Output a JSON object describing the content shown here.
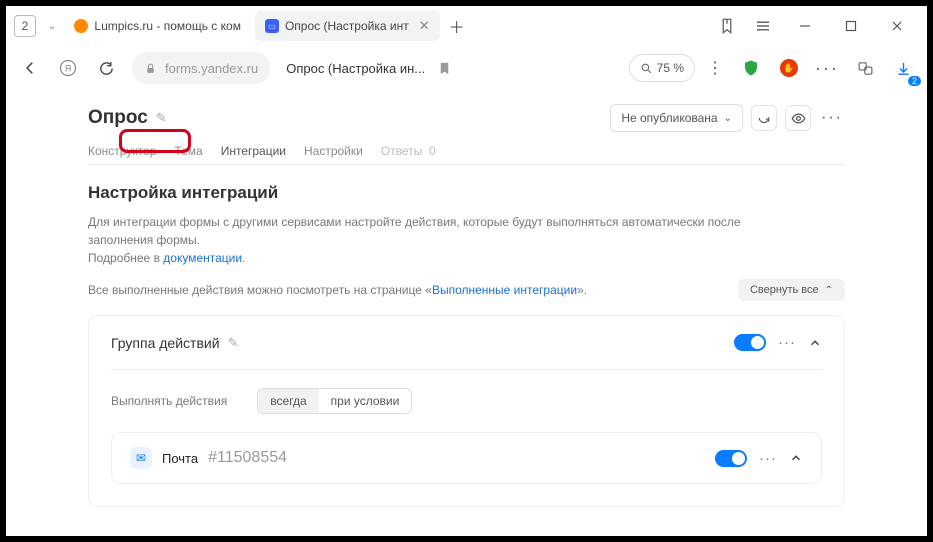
{
  "browser": {
    "tab_count": "2",
    "tabs": [
      {
        "label": "Lumpics.ru - помощь с ком"
      },
      {
        "label": "Опрос (Настройка инт"
      }
    ],
    "domain": "forms.yandex.ru",
    "page_title": "Опрос (Настройка ин...",
    "zoom": "75 %",
    "notif_badge": "2"
  },
  "form": {
    "title": "Опрос",
    "publish_status": "Не опубликована",
    "tabs": {
      "constructor": "Конструктор",
      "theme": "Тема",
      "integrations": "Интеграции",
      "settings": "Настройки",
      "answers_label": "Ответы",
      "answers_count": "0"
    }
  },
  "section": {
    "title": "Настройка интеграций",
    "desc1": "Для интеграции формы с другими сервисами настройте действия, которые будут выполняться автоматически после заполнения формы.",
    "desc2a": "Подробнее в ",
    "desc2_link": "документации",
    "desc3a": "Все выполненные действия можно посмотреть на странице «",
    "desc3_link": "Выполненные интеграции",
    "desc3b": "».",
    "collapse_all": "Свернуть все"
  },
  "group": {
    "title": "Группа действий",
    "perform_label": "Выполнять действия",
    "seg_always": "всегда",
    "seg_cond": "при условии",
    "mail_label": "Почта",
    "mail_id": "#11508554"
  }
}
